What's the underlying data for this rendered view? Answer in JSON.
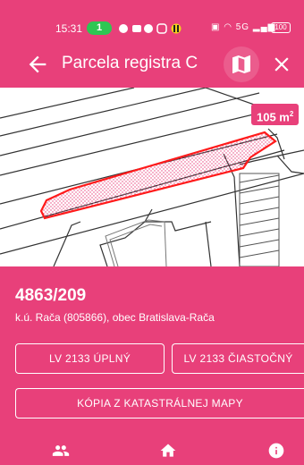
{
  "status_bar": {
    "time": "15:31",
    "call_badge": "1",
    "battery": "100",
    "network": "5G"
  },
  "app_bar": {
    "title": "Parcela registra C",
    "back_icon": "arrow-back-icon",
    "map_icon": "map-icon",
    "close_icon": "close-icon"
  },
  "map": {
    "area_value": "105 m",
    "area_unit_superscript": "2"
  },
  "parcel": {
    "number": "4863/209",
    "location": "k.ú. Rača (805866), obec Bratislava-Rača"
  },
  "actions": {
    "lv_full": "LV 2133 ÚPLNÝ",
    "lv_partial": "LV 2133 ČIASTOČNÝ",
    "cadastral_copy": "KÓPIA Z KATASTRÁLNEJ MAPY"
  },
  "bottom_nav": {
    "left_icon": "people-icon",
    "center_icon": "home-icon",
    "right_icon": "info-icon"
  },
  "colors": {
    "accent": "#e8407a",
    "parcel_outline": "#ff1a1a",
    "call_green": "#2ec653"
  }
}
